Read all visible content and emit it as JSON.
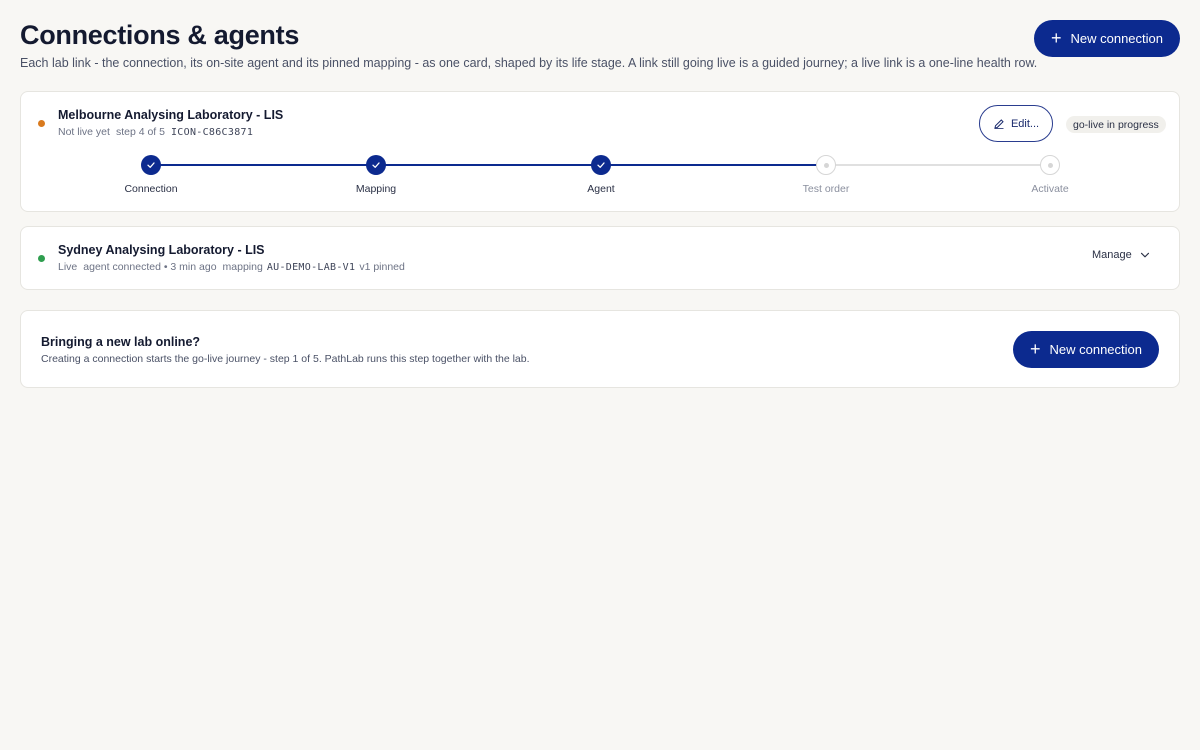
{
  "header": {
    "title": "Connections & agents",
    "subtitle": "Each lab link - the connection, its on-site agent and its pinned mapping - as one card, shaped by its life stage. A link still going live is a guided journey; a live link is a one-line health row.",
    "new_connection_label": "New connection"
  },
  "colors": {
    "primary": "#0c2a8f",
    "status_in_progress": "#d97a1e",
    "status_live": "#2f9e4f"
  },
  "connections": [
    {
      "name": "Melbourne Analysing Laboratory - LIS",
      "status": "Not live yet",
      "step_text": "step 4 of 5",
      "code": "ICON-C86C3871",
      "edit_label": "Edit...",
      "badge": "go-live in progress",
      "steps": [
        {
          "label": "Connection",
          "done": true
        },
        {
          "label": "Mapping",
          "done": true
        },
        {
          "label": "Agent",
          "done": true
        },
        {
          "label": "Test order",
          "done": false
        },
        {
          "label": "Activate",
          "done": false
        }
      ]
    },
    {
      "name": "Sydney Analysing Laboratory - LIS",
      "status": "Live",
      "agent_text": "agent connected • 3 min ago",
      "mapping_prefix": "mapping",
      "mapping_code": "AU-DEMO-LAB-V1",
      "mapping_suffix": "v1 pinned",
      "manage_label": "Manage"
    }
  ],
  "new_lab": {
    "title": "Bringing a new lab online?",
    "description": "Creating a connection starts the go-live journey - step 1 of 5. PathLab runs this step together with the lab.",
    "button_label": "New connection"
  },
  "icons": {
    "plus": "plus-icon",
    "edit": "pencil-icon",
    "check": "check-icon",
    "chevron": "chevron-down-icon"
  }
}
